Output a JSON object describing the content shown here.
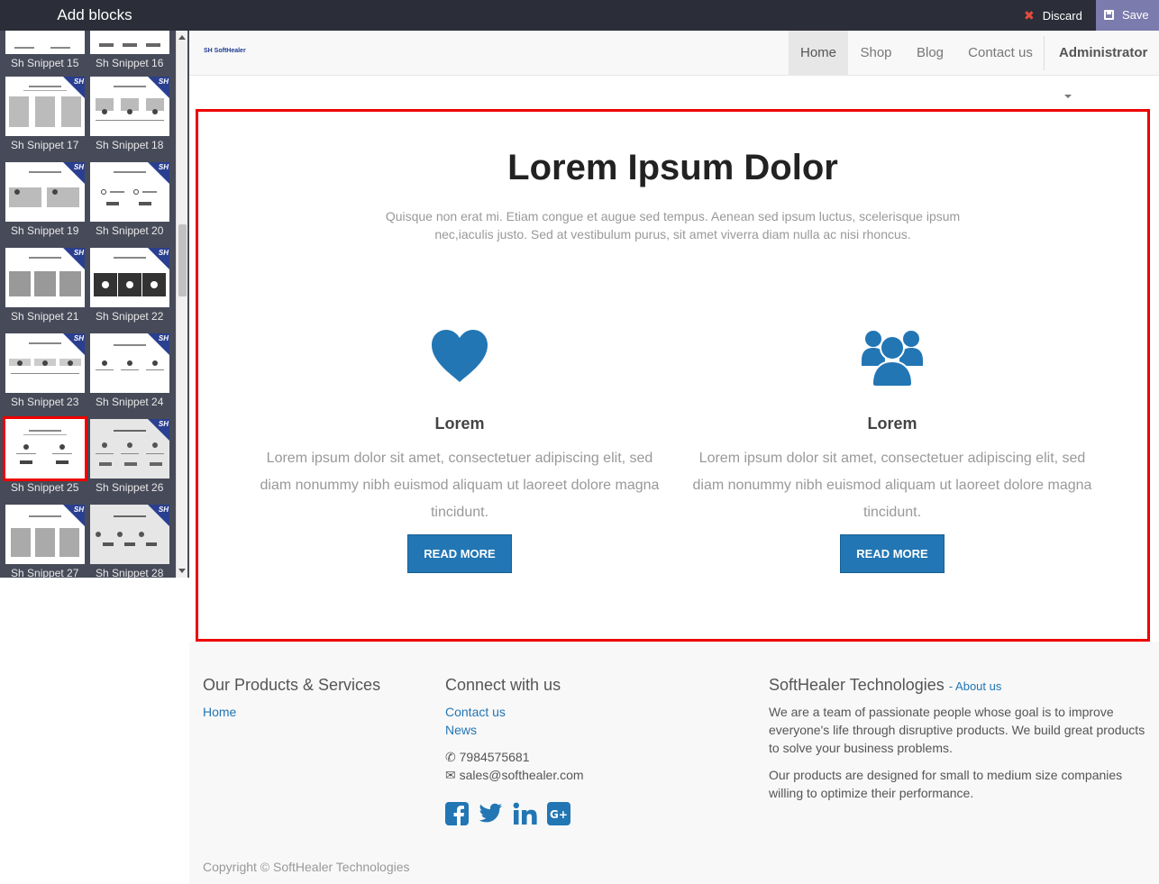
{
  "sidebar": {
    "title": "Add blocks",
    "snippets": [
      {
        "label": "Sh Snippet 15"
      },
      {
        "label": "Sh Snippet 16"
      },
      {
        "label": "Sh Snippet 17"
      },
      {
        "label": "Sh Snippet 18"
      },
      {
        "label": "Sh Snippet 19"
      },
      {
        "label": "Sh Snippet 20"
      },
      {
        "label": "Sh Snippet 21"
      },
      {
        "label": "Sh Snippet 22"
      },
      {
        "label": "Sh Snippet 23"
      },
      {
        "label": "Sh Snippet 24"
      },
      {
        "label": "Sh Snippet 25",
        "selected": true
      },
      {
        "label": "Sh Snippet 26"
      },
      {
        "label": "Sh Snippet 27"
      },
      {
        "label": "Sh Snippet 28"
      }
    ],
    "badge": "SH"
  },
  "toolbar": {
    "discard_label": "Discard",
    "save_label": "Save"
  },
  "nav": {
    "logo": "SH SoftHealer",
    "items": [
      "Home",
      "Shop",
      "Blog",
      "Contact us"
    ],
    "active": "Home",
    "user": "Administrator"
  },
  "hero": {
    "title": "Lorem Ipsum Dolor",
    "subtitle": "Quisque non erat mi. Etiam congue et augue sed tempus. Aenean sed ipsum luctus, scelerisque ipsum nec,iaculis justo. Sed at vestibulum purus, sit amet viverra diam nulla ac nisi rhoncus.",
    "features": [
      {
        "icon": "heart-icon",
        "heading": "Lorem",
        "text": "Lorem ipsum dolor sit amet, consectetuer adipiscing elit, sed diam nonummy nibh euismod aliquam ut laoreet dolore magna tincidunt.",
        "button": "READ MORE"
      },
      {
        "icon": "users-icon",
        "heading": "Lorem",
        "text": "Lorem ipsum dolor sit amet, consectetuer adipiscing elit, sed diam nonummy nibh euismod aliquam ut laoreet dolore magna tincidunt.",
        "button": "READ MORE"
      }
    ],
    "accent": "#2276b4",
    "selection_color": "#ee0000"
  },
  "footer": {
    "products": {
      "title": "Our Products & Services",
      "links": [
        "Home"
      ]
    },
    "connect": {
      "title": "Connect with us",
      "links": [
        "Contact us",
        "News"
      ],
      "phone": "7984575681",
      "email": "sales@softhealer.com"
    },
    "company": {
      "title": "SoftHealer Technologies",
      "about_link": "About us",
      "p1": "We are a team of passionate people whose goal is to improve everyone's life through disruptive products. We build great products to solve your business problems.",
      "p2": "Our products are designed for small to medium size companies willing to optimize their performance."
    },
    "copyright": "Copyright © SoftHealer Technologies"
  }
}
